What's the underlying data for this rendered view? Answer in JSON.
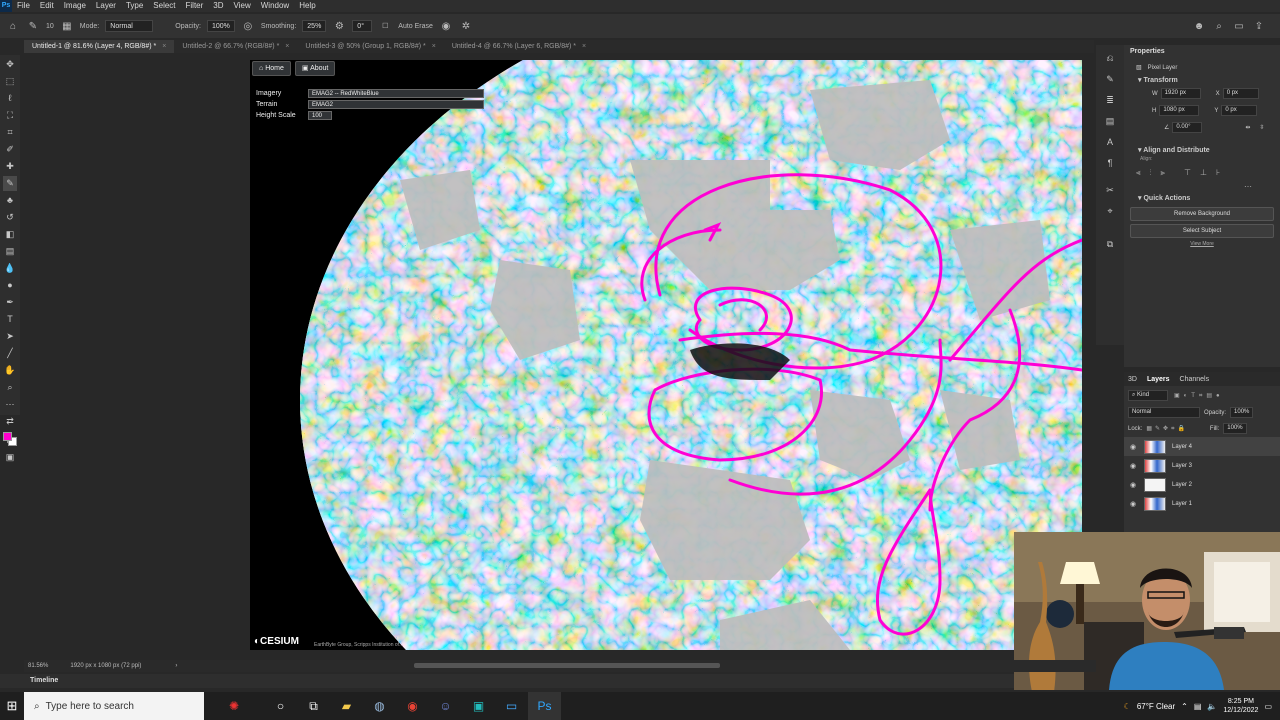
{
  "app": {
    "logo": "Ps"
  },
  "menu": [
    "File",
    "Edit",
    "Image",
    "Layer",
    "Type",
    "Select",
    "Filter",
    "3D",
    "View",
    "Window",
    "Help"
  ],
  "options_bar": {
    "mode_label": "Mode:",
    "mode_value": "Normal",
    "opacity_label": "Opacity:",
    "opacity_value": "100%",
    "smoothing_label": "Smoothing:",
    "smoothing_value": "25%",
    "angle_value": "0°",
    "auto_erase_label": "Auto Erase",
    "brush_size": "10"
  },
  "tabs": [
    {
      "label": "Untitled-1 @ 81.6% (Layer 4, RGB/8#) *",
      "active": true
    },
    {
      "label": "Untitled-2 @ 66.7% (RGB/8#) *",
      "active": false
    },
    {
      "label": "Untitled-3 @ 50% (Group 1, RGB/8#) *",
      "active": false
    },
    {
      "label": "Untitled-4 @ 66.7% (Layer 6, RGB/8#) *",
      "active": false
    }
  ],
  "cesium": {
    "home_label": "Home",
    "about_label": "About",
    "imagery_label": "Imagery",
    "imagery_value": "EMAG2 -- RedWhiteBlue",
    "terrain_label": "Terrain",
    "terrain_value": "EMAG2",
    "height_label": "Height Scale",
    "height_value": "100",
    "logo_text": "CESIUM",
    "credit": "EarthByte Group, Scripps Institution of..."
  },
  "properties": {
    "tab_label": "Properties",
    "kind_label": "Pixel Layer",
    "transform_label": "Transform",
    "w_label": "W",
    "w_value": "1920 px",
    "h_label": "H",
    "h_value": "1080 px",
    "x_label": "X",
    "x_value": "0 px",
    "y_label": "Y",
    "y_value": "0 px",
    "angle_value": "0.00°",
    "align_label": "Align and Distribute",
    "align_sub": "Align:",
    "quick_label": "Quick Actions",
    "remove_bg": "Remove Background",
    "select_subject": "Select Subject",
    "view_more": "View More"
  },
  "layers_panel": {
    "tabs": [
      "3D",
      "Layers",
      "Channels"
    ],
    "kind": "Kind",
    "blend": "Normal",
    "opacity_label": "Opacity:",
    "opacity_value": "100%",
    "lock_label": "Lock:",
    "fill_label": "Fill:",
    "fill_value": "100%",
    "layers": [
      {
        "name": "Layer 4",
        "selected": true
      },
      {
        "name": "Layer 3",
        "selected": false
      },
      {
        "name": "Layer 2",
        "selected": false
      },
      {
        "name": "Layer 1",
        "selected": false
      }
    ]
  },
  "status": {
    "zoom": "81.56%",
    "doc_size": "1920 px x 1080 px (72 ppi)"
  },
  "timeline_label": "Timeline",
  "taskbar": {
    "search_placeholder": "Type here to search",
    "weather": "67°F Clear",
    "time": "8:25 PM",
    "date": "12/12/2022"
  },
  "colors": {
    "foreground": "#ff00cc",
    "background": "#ffffff",
    "annotation": "#ff00d4"
  }
}
